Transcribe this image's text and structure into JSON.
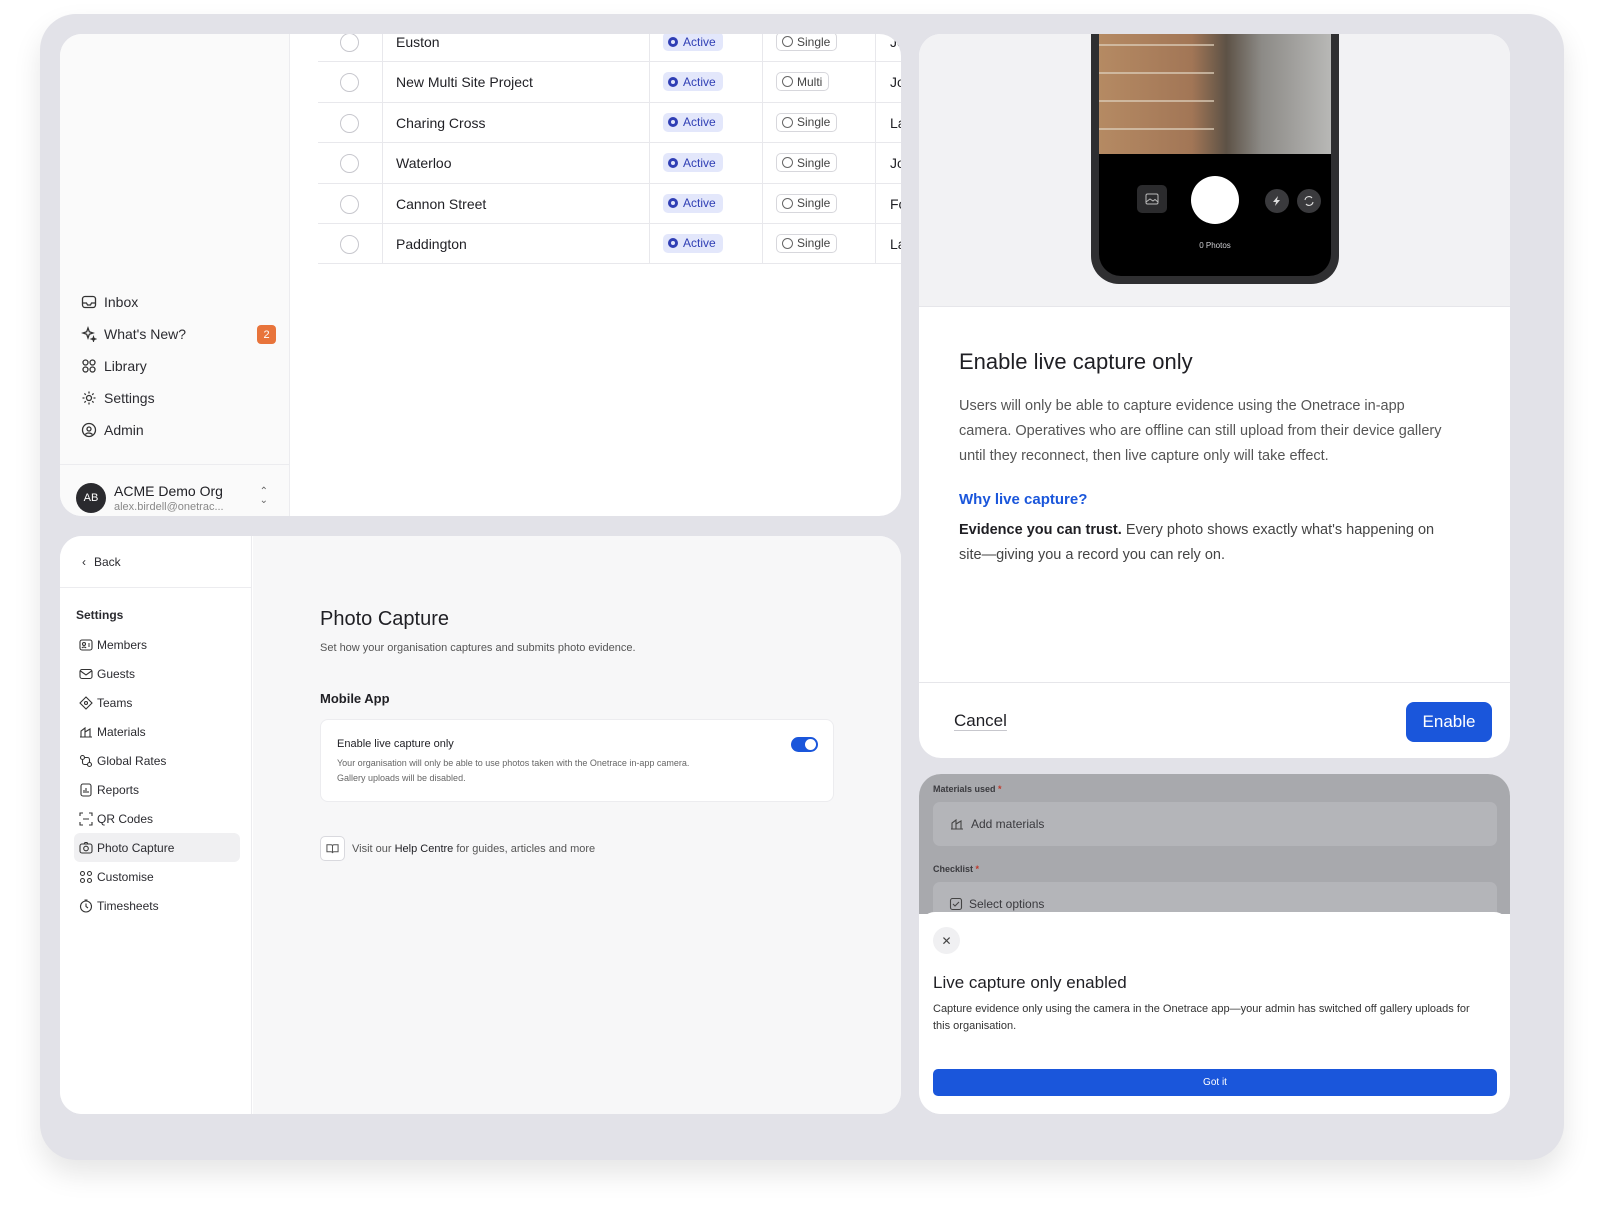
{
  "projects_panel": {
    "rows": [
      {
        "name": "Euston",
        "status": "Active",
        "type": "Single",
        "owner": "Jo"
      },
      {
        "name": "New Multi Site Project",
        "status": "Active",
        "type": "Multi",
        "owner": "Jo"
      },
      {
        "name": "Charing Cross",
        "status": "Active",
        "type": "Single",
        "owner": "La"
      },
      {
        "name": "Waterloo",
        "status": "Active",
        "type": "Single",
        "owner": "Jo"
      },
      {
        "name": "Cannon Street",
        "status": "Active",
        "type": "Single",
        "owner": "Fo"
      },
      {
        "name": "Paddington",
        "status": "Active",
        "type": "Single",
        "owner": "La"
      }
    ],
    "nav": {
      "inbox": "Inbox",
      "whats_new": "What's New?",
      "whats_new_count": "2",
      "library": "Library",
      "settings": "Settings",
      "admin": "Admin"
    },
    "org": {
      "initials": "AB",
      "name": "ACME Demo Org",
      "email": "alex.birdell@onetrac..."
    }
  },
  "settings_panel": {
    "back": "Back",
    "heading": "Settings",
    "items": {
      "members": "Members",
      "guests": "Guests",
      "teams": "Teams",
      "materials": "Materials",
      "global_rates": "Global Rates",
      "reports": "Reports",
      "qr_codes": "QR Codes",
      "photo_capture": "Photo Capture",
      "customise": "Customise",
      "timesheets": "Timesheets"
    },
    "title": "Photo Capture",
    "subtitle": "Set how your organisation captures and submits photo evidence.",
    "section": "Mobile App",
    "card_title": "Enable live capture only",
    "card_desc": "Your organisation will only be able to use photos taken with the Onetrace in-app camera. Gallery uploads will be disabled.",
    "toggle_on": true,
    "help_prefix": "Visit our",
    "help_link": "Help Centre",
    "help_suffix": "for guides, articles and more"
  },
  "modal_panel": {
    "photos_count": "0 Photos",
    "title": "Enable live capture only",
    "body": "Users will only be able to capture evidence using the Onetrace in-app camera. Operatives who are offline can still upload from their device gallery until they reconnect, then live capture only will take effect.",
    "why": "Why live capture?",
    "trust_bold": "Evidence you can trust.",
    "trust_rest": "Every photo shows exactly what's happening on site—giving you a record you can rely on.",
    "cancel": "Cancel",
    "enable": "Enable"
  },
  "mobile_panel": {
    "materials_label": "Materials used",
    "materials_placeholder": "Add materials",
    "checklist_label": "Checklist",
    "checklist_placeholder": "Select options",
    "required_mark": "*",
    "sheet_title": "Live capture only enabled",
    "sheet_body": "Capture evidence only using the camera in the Onetrace app—your admin has switched off gallery uploads for this organisation.",
    "got_it": "Got it"
  },
  "colors": {
    "accent": "#1a56db",
    "badge_orange": "#e8743b",
    "active_pill_bg": "#e3e7fb",
    "active_pill_text": "#2f3eb4"
  },
  "icons": [
    "inbox-icon",
    "sparkle-icon",
    "library-icon",
    "gear-icon",
    "admin-icon",
    "chevron-up-down-icon",
    "chevron-left-icon",
    "members-icon",
    "mail-icon",
    "teams-icon",
    "materials-icon",
    "global-rates-icon",
    "reports-icon",
    "qr-code-icon",
    "camera-icon",
    "customise-icon",
    "clock-icon",
    "book-icon",
    "gallery-icon",
    "flash-icon",
    "flip-camera-icon",
    "close-icon"
  ]
}
